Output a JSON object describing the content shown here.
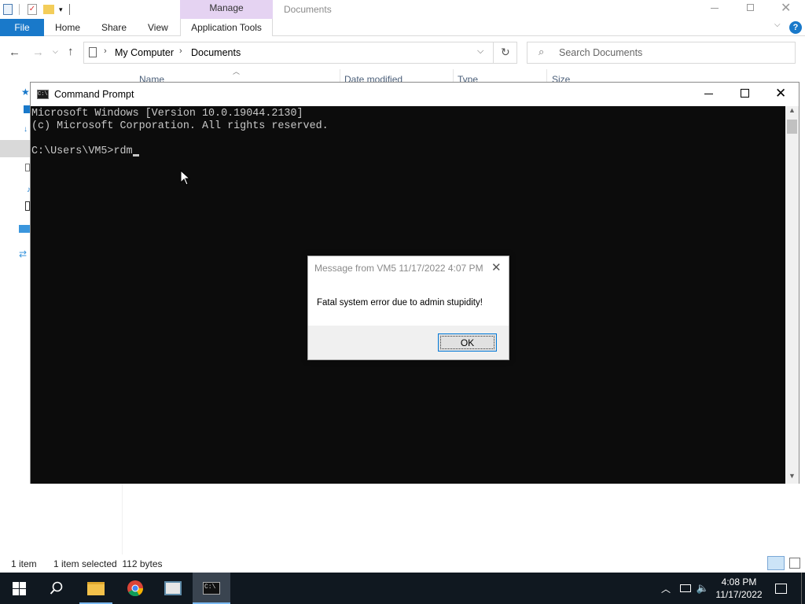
{
  "explorer": {
    "window_title": "Documents",
    "context_tab": "Manage",
    "tabs": [
      "File",
      "Home",
      "Share",
      "View",
      "Application Tools"
    ],
    "breadcrumb": [
      "My Computer",
      "Documents"
    ],
    "search_placeholder": "Search Documents",
    "columns": [
      "Name",
      "Date modified",
      "Type",
      "Size"
    ],
    "status": {
      "item_count": "1 item",
      "selected": "1 item selected  112 bytes"
    }
  },
  "cmd": {
    "title": "Command Prompt",
    "lines": [
      "Microsoft Windows [Version 10.0.19044.2130]",
      "(c) Microsoft Corporation. All rights reserved.",
      "",
      "C:\\Users\\VM5>rdm"
    ]
  },
  "message": {
    "title": "Message from VM5 11/17/2022 4:07 PM",
    "body": "Fatal system error due to admin stupidity!",
    "ok_label": "OK"
  },
  "taskbar": {
    "time": "4:08 PM",
    "date": "11/17/2022"
  },
  "colors": {
    "file_tab": "#1979ca",
    "manage_band": "#e5d3f2",
    "taskbar": "#101820",
    "console_bg": "#0c0c0c"
  }
}
